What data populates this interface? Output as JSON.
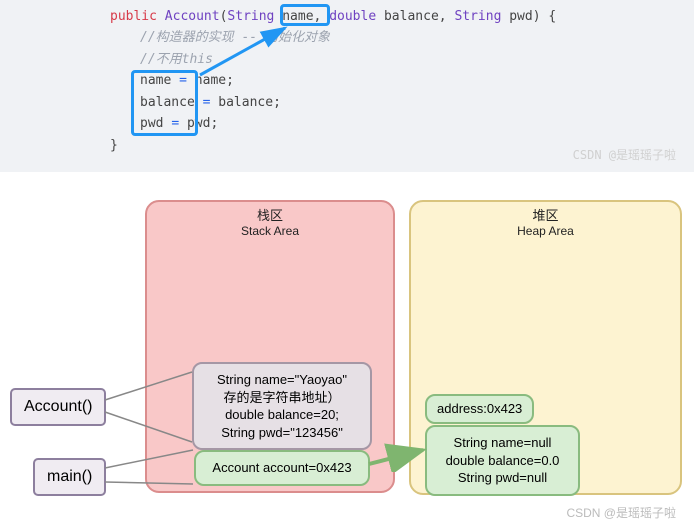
{
  "code": {
    "sig_public": "public",
    "sig_class": "Account",
    "sig_type1": "String",
    "sig_param1": "name",
    "sig_type2": "double",
    "sig_param2": "balance",
    "sig_type3": "String",
    "sig_param3": "pwd",
    "comment1": "//构造器的实现 -- 初始化对象",
    "comment2": "//不用this",
    "line3_l": "name",
    "line3_r": "name",
    "line4_l": "balance",
    "line4_r": "balance",
    "line5_l": "pwd",
    "line5_r": "pwd",
    "eq": "="
  },
  "watermark1": "CSDN @是瑶瑶子啦",
  "watermark2": "CSDN @是瑶瑶子啦",
  "stack": {
    "title_cn": "栈区",
    "title_en": "Stack Area",
    "frame1_l1": "String name=\"Yaoyao\"",
    "frame1_l2": "存的是字符串地址）",
    "frame1_l3": "double balance=20;",
    "frame1_l4": "String pwd=\"123456\"",
    "frame2": "Account account=0x423"
  },
  "heap": {
    "title_cn": "堆区",
    "title_en": "Heap Area",
    "addr": "address:0x423",
    "obj_l1": "String name=null",
    "obj_l2": "double balance=0.0",
    "obj_l3": "String pwd=null"
  },
  "buttons": {
    "account": "Account()",
    "main": "main()"
  }
}
